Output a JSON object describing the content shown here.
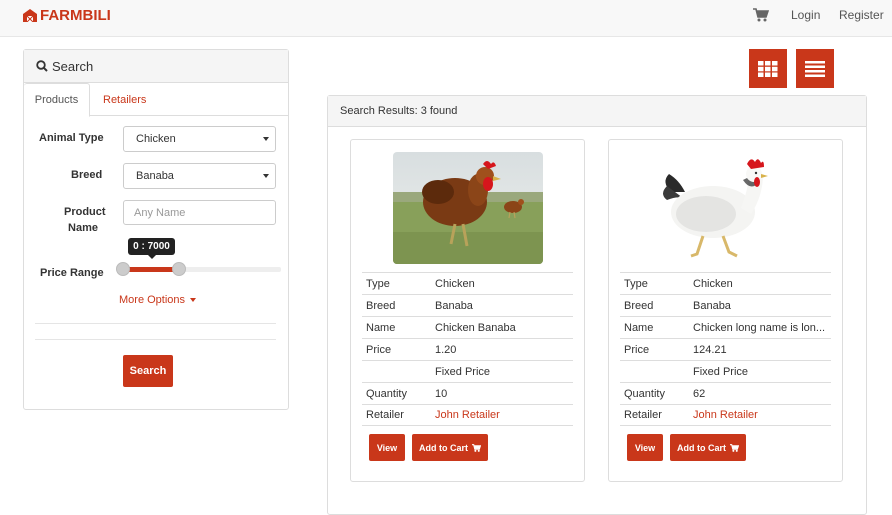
{
  "navbar": {
    "brand": "FARMBILI",
    "login": "Login",
    "register": "Register"
  },
  "search": {
    "heading": "Search",
    "tabs": [
      "Products",
      "Retailers"
    ],
    "animal_type_label": "Animal Type",
    "animal_type_value": "Chicken",
    "breed_label": "Breed",
    "breed_value": "Banaba",
    "product_name_label_1": "Product",
    "product_name_label_2": "Name",
    "product_name_placeholder": "Any Name",
    "price_range_label": "Price Range",
    "price_range_tooltip": "0 : 7000",
    "price_range_min_fraction": 0.0,
    "price_range_max_fraction": 0.35,
    "more_options": "More Options",
    "search_button": "Search"
  },
  "results": {
    "heading": "Search Results: 3 found",
    "cards": [
      {
        "type_label": "Type",
        "type": "Chicken",
        "breed_label": "Breed",
        "breed": "Banaba",
        "name_label": "Name",
        "name": "Chicken Banaba",
        "price_label": "Price",
        "price": "1.20",
        "price_note": "Fixed Price",
        "quantity_label": "Quantity",
        "quantity": "10",
        "retailer_label": "Retailer",
        "retailer": "John Retailer",
        "view_button": "View",
        "cart_button": "Add to Cart"
      },
      {
        "type_label": "Type",
        "type": "Chicken",
        "breed_label": "Breed",
        "breed": "Banaba",
        "name_label": "Name",
        "name": "Chicken long name is lon...",
        "price_label": "Price",
        "price": "124.21",
        "price_note": "Fixed Price",
        "quantity_label": "Quantity",
        "quantity": "62",
        "retailer_label": "Retailer",
        "retailer": "John Retailer",
        "view_button": "View",
        "cart_button": "Add to Cart"
      }
    ]
  },
  "colors": {
    "accent": "#c9371a",
    "panel_heading": "#f5f5f5",
    "border": "#dddddd"
  },
  "icons": [
    "barn-icon",
    "cart-icon",
    "search-icon",
    "grid-view-icon",
    "list-view-icon"
  ]
}
